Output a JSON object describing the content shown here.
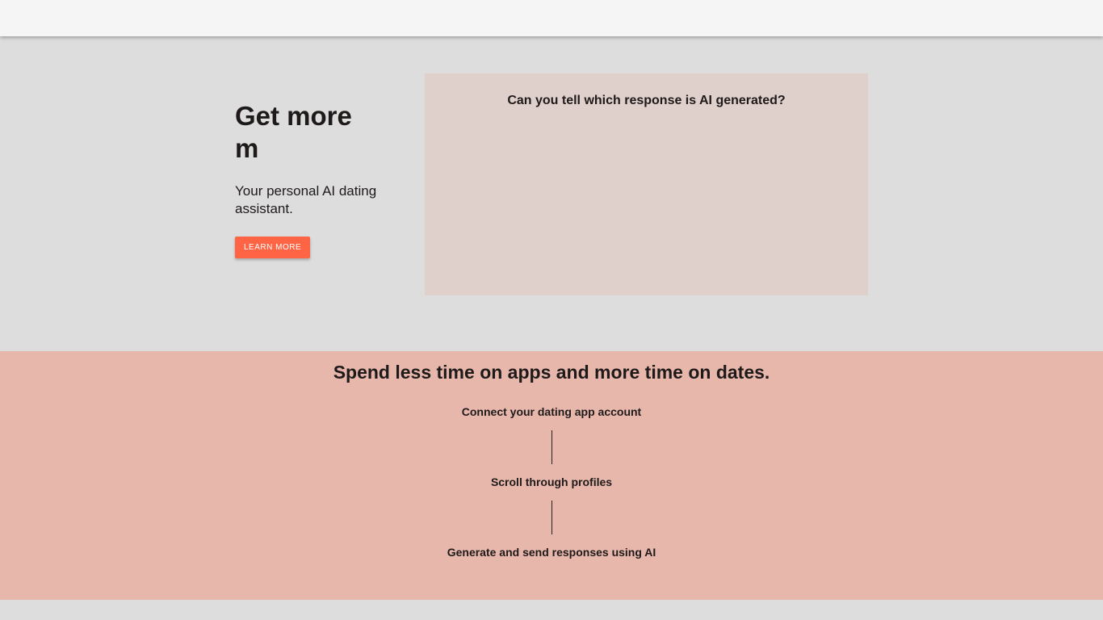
{
  "hero": {
    "title": "Get more m",
    "subtitle": "Your personal AI dating assistant.",
    "cta_label": "LEARN MORE"
  },
  "demo": {
    "question": "Can you tell which response is AI generated?"
  },
  "how_it_works": {
    "heading": "Spend less time on apps and more time on dates.",
    "steps": [
      {
        "label": "Connect your dating app account"
      },
      {
        "label": "Scroll through profiles"
      },
      {
        "label": "Generate and send responses using AI"
      }
    ]
  },
  "colors": {
    "accent": "#ff6545",
    "steps_background": "#e8b7ac",
    "card_background": "#e0d0cc",
    "page_background": "#dddddd"
  }
}
